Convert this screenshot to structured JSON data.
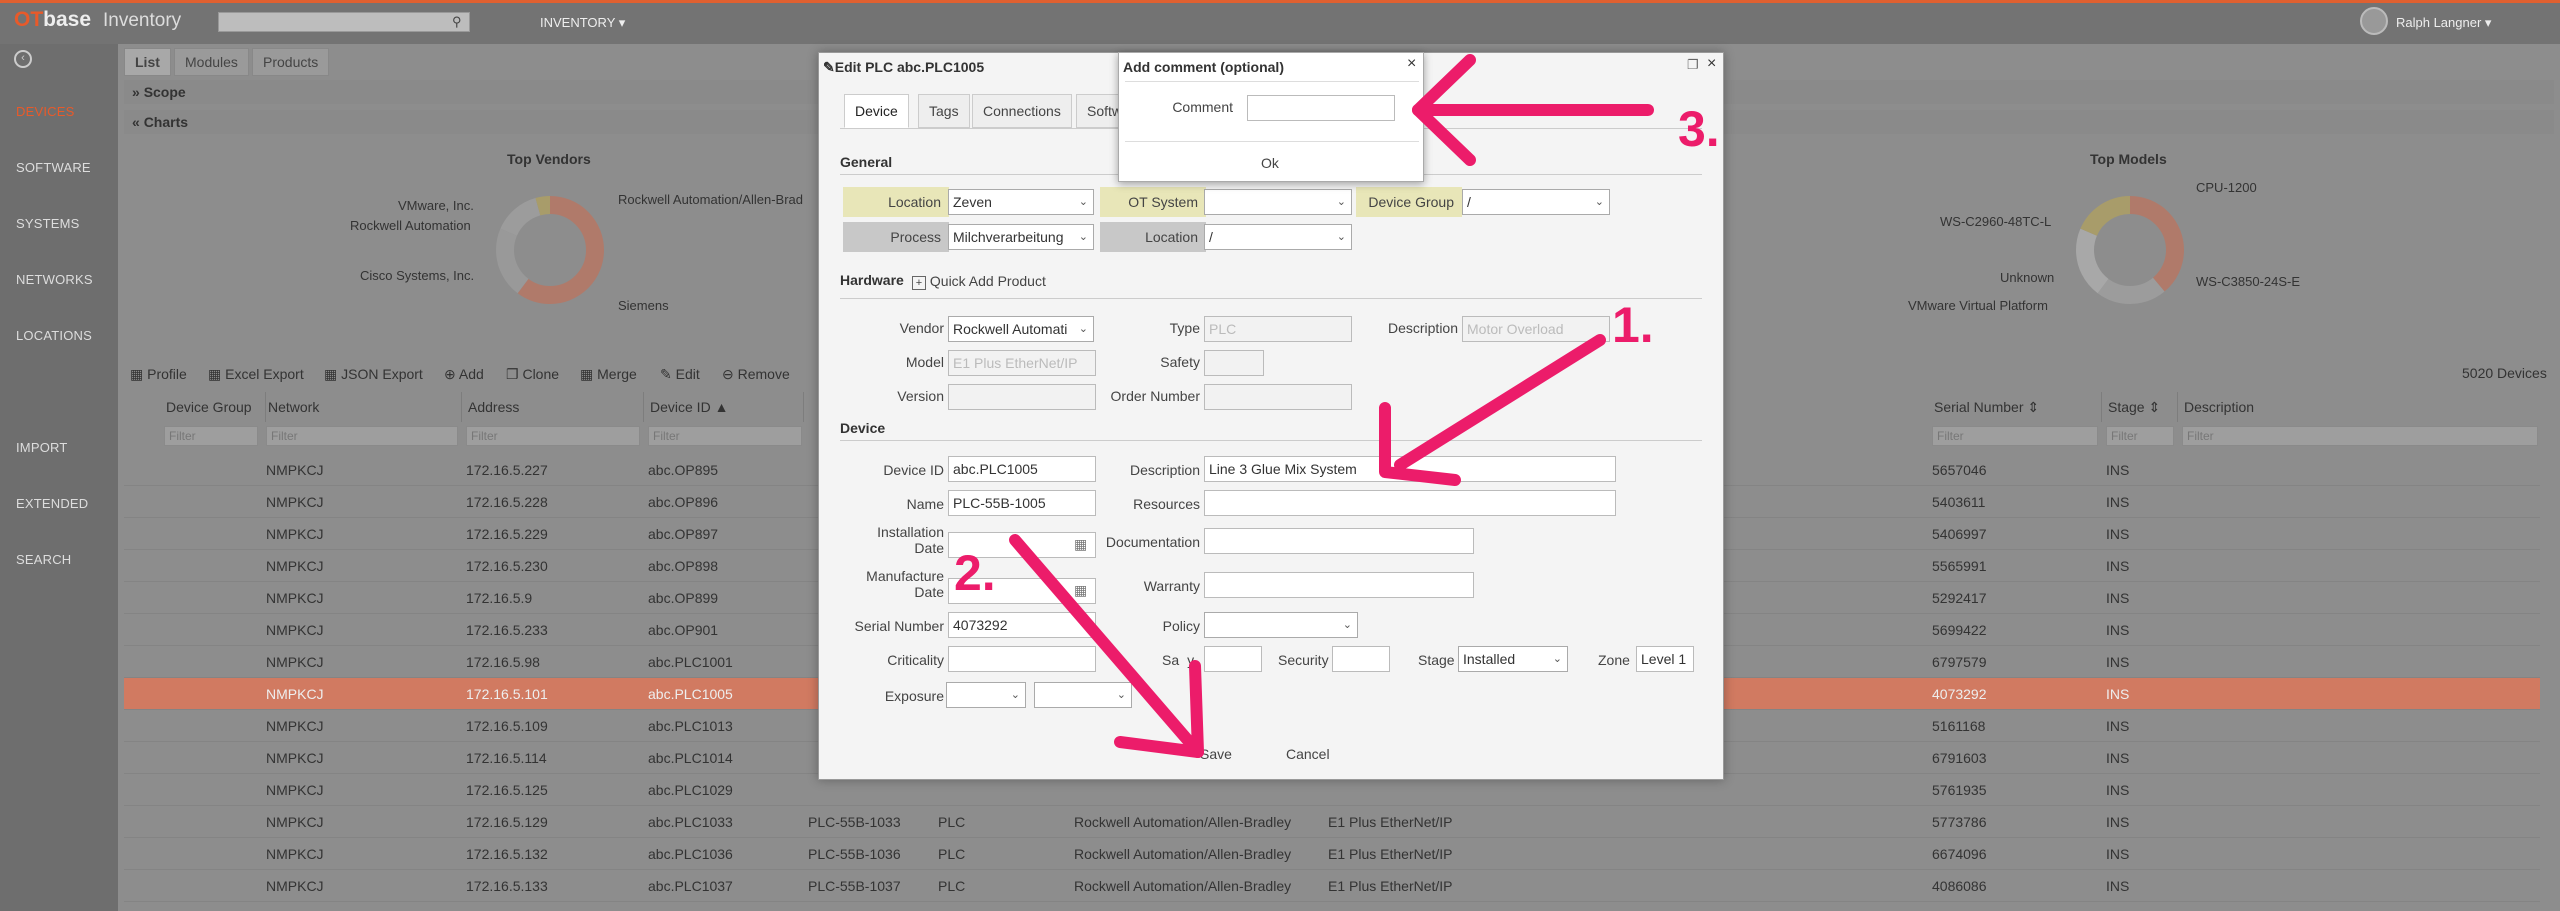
{
  "app": {
    "logo_ot": "OT",
    "logo_base": "base",
    "name": "Inventory",
    "menu": "INVENTORY ▾",
    "user": "Ralph Langner ▾"
  },
  "sidebar": {
    "items": [
      "DEVICES",
      "SOFTWARE",
      "SYSTEMS",
      "NETWORKS",
      "LOCATIONS",
      "IMPORT",
      "EXTENDED",
      "SEARCH"
    ]
  },
  "tabs": [
    "List",
    "Modules",
    "Products"
  ],
  "sections": {
    "scope": "Scope",
    "charts": "Charts"
  },
  "charts": {
    "vendors": {
      "title": "Top Vendors",
      "labels": [
        "VMware, Inc.",
        "Rockwell Automation",
        "Cisco Systems, Inc.",
        "Rockwell Automation/Allen-Brad",
        "Siemens"
      ]
    },
    "models": {
      "title": "Top Models",
      "labels": [
        "WS-C2960-48TC-L",
        "Unknown",
        "VMware Virtual Platform",
        "CPU-1200",
        "WS-C3850-24S-E"
      ]
    }
  },
  "toolbar": {
    "profile": "Profile",
    "excel": "Excel Export",
    "json": "JSON Export",
    "add": "Add",
    "clone": "Clone",
    "merge": "Merge",
    "edit": "Edit",
    "remove": "Remove",
    "count": "5020 Devices"
  },
  "columns": {
    "device_group": "Device Group ⇕",
    "network": "Network",
    "address": "Address",
    "device_id": "Device ID ▲",
    "serial": "Serial Number ⇕",
    "stage": "Stage ⇕",
    "description": "Description",
    "filter": "Filter"
  },
  "rows": [
    {
      "network": "NMPKCJ",
      "address": "172.16.5.227",
      "device_id": "abc.OP895",
      "name": "",
      "type": "",
      "vendor": "",
      "model": "",
      "serial": "5657046",
      "stage": "INS"
    },
    {
      "network": "NMPKCJ",
      "address": "172.16.5.228",
      "device_id": "abc.OP896",
      "name": "",
      "type": "",
      "vendor": "",
      "model": "",
      "serial": "5403611",
      "stage": "INS"
    },
    {
      "network": "NMPKCJ",
      "address": "172.16.5.229",
      "device_id": "abc.OP897",
      "name": "",
      "type": "",
      "vendor": "",
      "model": "",
      "serial": "5406997",
      "stage": "INS"
    },
    {
      "network": "NMPKCJ",
      "address": "172.16.5.230",
      "device_id": "abc.OP898",
      "name": "",
      "type": "",
      "vendor": "",
      "model": "",
      "serial": "5565991",
      "stage": "INS"
    },
    {
      "network": "NMPKCJ",
      "address": "172.16.5.9",
      "device_id": "abc.OP899",
      "name": "",
      "type": "",
      "vendor": "",
      "model": "",
      "serial": "5292417",
      "stage": "INS"
    },
    {
      "network": "NMPKCJ",
      "address": "172.16.5.233",
      "device_id": "abc.OP901",
      "name": "",
      "type": "",
      "vendor": "",
      "model": "",
      "serial": "5699422",
      "stage": "INS"
    },
    {
      "network": "NMPKCJ",
      "address": "172.16.5.98",
      "device_id": "abc.PLC1001",
      "name": "",
      "type": "",
      "vendor": "",
      "model": "",
      "serial": "6797579",
      "stage": "INS"
    },
    {
      "network": "NMPKCJ",
      "address": "172.16.5.101",
      "device_id": "abc.PLC1005",
      "name": "",
      "type": "",
      "vendor": "",
      "model": "",
      "serial": "4073292",
      "stage": "INS",
      "selected": true
    },
    {
      "network": "NMPKCJ",
      "address": "172.16.5.109",
      "device_id": "abc.PLC1013",
      "name": "",
      "type": "",
      "vendor": "",
      "model": "",
      "serial": "5161168",
      "stage": "INS"
    },
    {
      "network": "NMPKCJ",
      "address": "172.16.5.114",
      "device_id": "abc.PLC1014",
      "name": "",
      "type": "",
      "vendor": "",
      "model": "",
      "serial": "6791603",
      "stage": "INS"
    },
    {
      "network": "NMPKCJ",
      "address": "172.16.5.125",
      "device_id": "abc.PLC1029",
      "name": "",
      "type": "",
      "vendor": "",
      "model": "",
      "serial": "5761935",
      "stage": "INS"
    },
    {
      "network": "NMPKCJ",
      "address": "172.16.5.129",
      "device_id": "abc.PLC1033",
      "name": "PLC-55B-1033",
      "type": "PLC",
      "vendor": "Rockwell Automation/Allen-Bradley",
      "model": "E1 Plus EtherNet/IP",
      "serial": "5773786",
      "stage": "INS"
    },
    {
      "network": "NMPKCJ",
      "address": "172.16.5.132",
      "device_id": "abc.PLC1036",
      "name": "PLC-55B-1036",
      "type": "PLC",
      "vendor": "Rockwell Automation/Allen-Bradley",
      "model": "E1 Plus EtherNet/IP",
      "serial": "6674096",
      "stage": "INS"
    },
    {
      "network": "NMPKCJ",
      "address": "172.16.5.133",
      "device_id": "abc.PLC1037",
      "name": "PLC-55B-1037",
      "type": "PLC",
      "vendor": "Rockwell Automation/Allen-Bradley",
      "model": "E1 Plus EtherNet/IP",
      "serial": "4086086",
      "stage": "INS"
    }
  ],
  "dialog": {
    "title": "Edit PLC abc.PLC1005",
    "tabs": [
      "Device",
      "Tags",
      "Connections",
      "Softw"
    ],
    "general": {
      "heading": "General",
      "location_label": "Location",
      "location_value": "Zeven",
      "ot_system_label": "OT System",
      "ot_system_value": "",
      "device_group_label": "Device Group",
      "device_group_value": "/",
      "process_label": "Process",
      "process_value": "Milchverarbeitung",
      "location2_label": "Location",
      "location2_value": "/"
    },
    "hardware": {
      "heading": "Hardware",
      "quick_add": "Quick Add Product",
      "vendor_label": "Vendor",
      "vendor_value": "Rockwell Automati",
      "type_label": "Type",
      "type_value": "PLC",
      "description_label": "Description",
      "description_value": "Motor Overload",
      "model_label": "Model",
      "model_value": "E1 Plus EtherNet/IP",
      "safety_label": "Safety",
      "version_label": "Version",
      "order_label": "Order Number"
    },
    "device": {
      "heading": "Device",
      "device_id_label": "Device ID",
      "device_id_value": "abc.PLC1005",
      "description_label": "Description",
      "description_value": "Line 3 Glue Mix System",
      "name_label": "Name",
      "name_value": "PLC-55B-1005",
      "resources_label": "Resources",
      "install_label_1": "Installation",
      "install_label_2": "Date",
      "documentation_label": "Documentation",
      "manufacture_label_1": "Manufacture",
      "manufacture_label_2": "Date",
      "warranty_label": "Warranty",
      "serial_label": "Serial Number",
      "serial_value": "4073292",
      "policy_label": "Policy",
      "criticality_label": "Criticality",
      "safety_label": "Sa",
      "safety_label_tail": "y",
      "security_label": "Security",
      "stage_label": "Stage",
      "stage_value": "Installed",
      "zone_label": "Zone",
      "zone_value": "Level 1",
      "exposure_label": "Exposure"
    },
    "save": "Save",
    "cancel": "Cancel"
  },
  "popup": {
    "title": "Add comment (optional)",
    "comment_label": "Comment",
    "comment_value": "",
    "ok": "Ok"
  },
  "annotations": [
    "1.",
    "2.",
    "3."
  ],
  "colors": {
    "accent": "#e85a2a",
    "annotation": "#ec1c6a",
    "selected_row": "#d17a61",
    "yellow_label": "#e8e6b8"
  }
}
